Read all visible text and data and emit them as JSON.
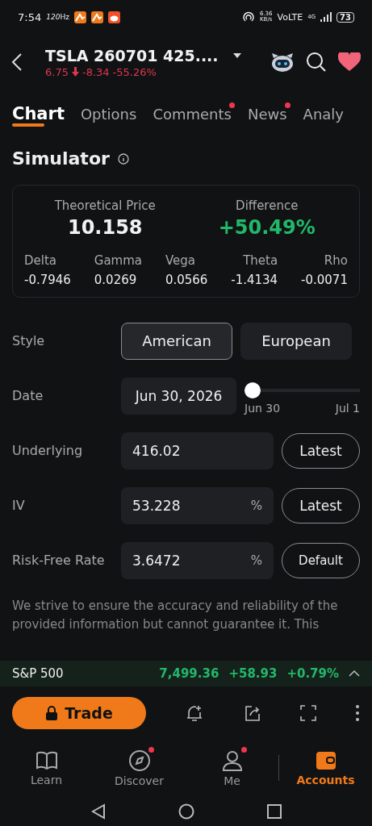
{
  "status_bar": {
    "time": "7:54",
    "refresh": "120",
    "refresh_unit": "Hz",
    "speed": "6.36",
    "speed_unit": "KB/s",
    "network": "VoLTE",
    "signal_type": "4G",
    "battery": "73"
  },
  "header": {
    "title": "TSLA 260701 425....",
    "price": "6.75",
    "change": "-8.34",
    "change_pct": "-55.26%"
  },
  "tabs": [
    {
      "label": "Chart",
      "selected": true,
      "badge": false
    },
    {
      "label": "Options",
      "selected": false,
      "badge": false
    },
    {
      "label": "Comments",
      "selected": false,
      "badge": true
    },
    {
      "label": "News",
      "selected": false,
      "badge": true
    },
    {
      "label": "Analy",
      "selected": false,
      "badge": false
    }
  ],
  "section_title": "Simulator",
  "summary": {
    "theoretical_label": "Theoretical Price",
    "theoretical_value": "10.158",
    "difference_label": "Difference",
    "difference_value": "+50.49%",
    "greeks": [
      {
        "label": "Delta",
        "value": "-0.7946"
      },
      {
        "label": "Gamma",
        "value": "0.0269"
      },
      {
        "label": "Vega",
        "value": "0.0566"
      },
      {
        "label": "Theta",
        "value": "-1.4134"
      },
      {
        "label": "Rho",
        "value": "-0.0071"
      }
    ]
  },
  "style": {
    "label": "Style",
    "options": [
      {
        "label": "American",
        "selected": true
      },
      {
        "label": "European",
        "selected": false
      }
    ]
  },
  "date": {
    "label": "Date",
    "value": "Jun 30, 2026",
    "slider": {
      "level": 0,
      "start": "Jun 30",
      "end": "Jul 1"
    }
  },
  "inputs": [
    {
      "label": "Underlying",
      "value": "416.02",
      "button": "Latest"
    },
    {
      "label": "IV",
      "value": "53.228",
      "unit": "%",
      "button": "Latest"
    },
    {
      "label": "Risk-Free Rate",
      "value": "3.6472",
      "unit": "%",
      "button": "Default"
    }
  ],
  "disclaimer_lines": [
    "We strive to ensure the accuracy and reliability of the",
    "provided information but cannot guarantee it. This"
  ],
  "ticker": {
    "name": "S&P 500",
    "price": "7,499.36",
    "change": "+58.93",
    "change_pct": "+0.79%"
  },
  "trade_button": "Trade",
  "bottom_nav": [
    {
      "label": "Learn",
      "selected": false,
      "badge": false
    },
    {
      "label": "Discover",
      "selected": false,
      "badge": true
    },
    {
      "label": "Me",
      "selected": false,
      "badge": true
    },
    {
      "label": "Accounts",
      "selected": true,
      "badge": false
    }
  ]
}
